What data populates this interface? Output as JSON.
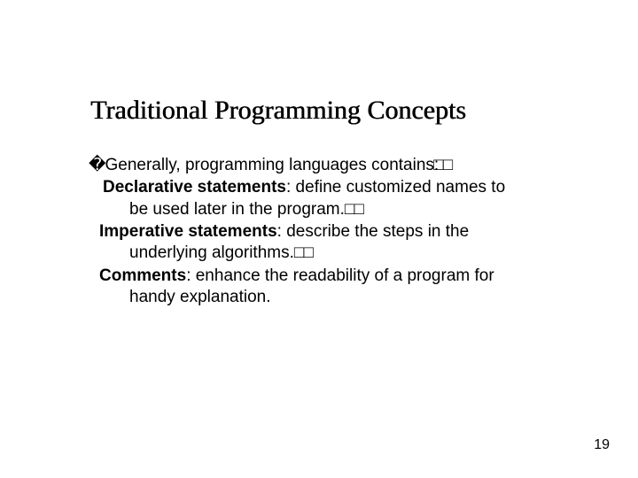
{
  "title": "Traditional Programming Concepts",
  "bullet_marker": "�",
  "trail_boxes": "□□",
  "lead_line": "Generally, programming languages contains:",
  "items": [
    {
      "term": "Declarative statements",
      "desc_line1": ": define customized names to",
      "desc_line2": "be used later in the program.",
      "trail": true
    },
    {
      "term": "Imperative statements",
      "desc_line1": ": describe the steps in the",
      "desc_line2": "underlying algorithms.",
      "trail": true
    },
    {
      "term": "Comments",
      "desc_line1": ": enhance the readability of a program for",
      "desc_line2": "handy explanation.",
      "trail": false
    }
  ],
  "page_number": "19"
}
